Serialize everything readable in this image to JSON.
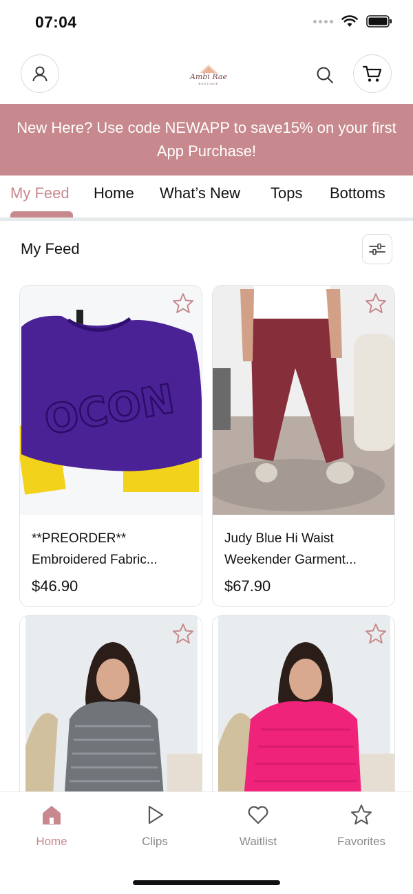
{
  "status_bar": {
    "time": "07:04"
  },
  "header": {
    "logo_text": "Ambi Rae",
    "logo_subtext": "BOUTIQUE"
  },
  "promo": {
    "text": "New Here? Use code NEWAPP to save15% on your first App Purchase!"
  },
  "tabs": [
    {
      "label": "My Feed",
      "active": true
    },
    {
      "label": "Home"
    },
    {
      "label": "What’s New"
    },
    {
      "label": "Tops"
    },
    {
      "label": "Bottoms"
    }
  ],
  "feed": {
    "title": "My Feed",
    "products": [
      {
        "name_line1": "**PREORDER**",
        "name_line2": "Embroidered Fabric...",
        "price": "$46.90",
        "image_text": "OCON"
      },
      {
        "name_line1": "Judy Blue Hi Waist",
        "name_line2": "Weekender Garment...",
        "price": "$67.90"
      },
      {
        "name_line1": "",
        "name_line2": "",
        "price": ""
      },
      {
        "name_line1": "",
        "name_line2": "",
        "price": ""
      }
    ]
  },
  "bottom_nav": [
    {
      "label": "Home",
      "icon": "home-icon",
      "active": true
    },
    {
      "label": "Clips",
      "icon": "play-icon"
    },
    {
      "label": "Waitlist",
      "icon": "heart-icon"
    },
    {
      "label": "Favorites",
      "icon": "star-icon"
    }
  ],
  "colors": {
    "accent": "#c7898d",
    "divider": "#e6eaea",
    "text": "#111111",
    "muted": "#8a8a8a"
  }
}
